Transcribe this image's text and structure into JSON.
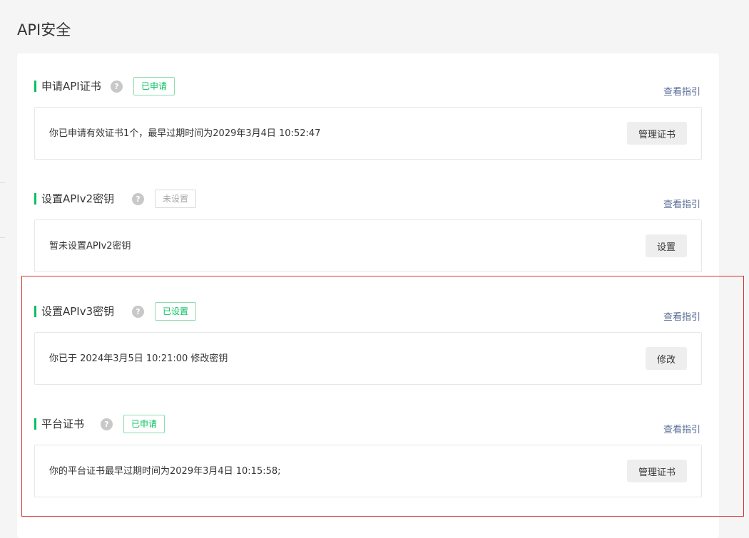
{
  "page": {
    "title": "API安全"
  },
  "sections": [
    {
      "title": "申请API证书",
      "help": "?",
      "status": "已申请",
      "guide": "查看指引",
      "description": "你已申请有效证书1个，最早过期时间为2029年3月4日 10:52:47",
      "button": "管理证书"
    },
    {
      "title": "设置APIv2密钥",
      "help": "?",
      "status": "未设置",
      "guide": "查看指引",
      "description": "暂未设置APIv2密钥",
      "button": "设置"
    },
    {
      "title": "设置APIv3密钥",
      "help": "?",
      "status": "已设置",
      "guide": "查看指引",
      "description": "你已于 2024年3月5日 10:21:00 修改密钥",
      "button": "修改"
    },
    {
      "title": "平台证书",
      "help": "?",
      "status": "已申请",
      "guide": "查看指引",
      "description": "你的平台证书最早过期时间为2029年3月4日 10:15:58;",
      "button": "管理证书"
    }
  ],
  "colors": {
    "accent": "#07c160",
    "link": "#576b95",
    "highlight": "#d43030",
    "inactive_badge": "#a6a6a6"
  }
}
